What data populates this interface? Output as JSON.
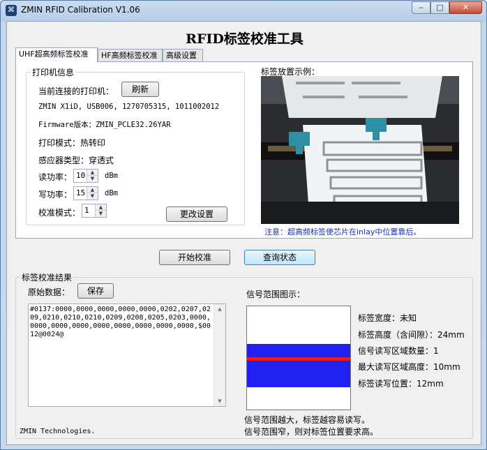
{
  "window": {
    "title": "ZMIN RFID Calibration V1.06",
    "minimize_glyph": "‒",
    "maximize_glyph": "□",
    "close_glyph": "✕"
  },
  "main_title": "RFID标签校准工具",
  "tabs": [
    {
      "label": "UHF超高频标签校准",
      "active": true
    },
    {
      "label": "HF高频标签校准",
      "active": false
    },
    {
      "label": "高级设置",
      "active": false
    }
  ],
  "printer_info": {
    "group_label": "打印机信息",
    "connected_label": "当前连接的打印机：",
    "refresh_button": "刷新",
    "printer_line": "ZMIN X1iD, USB006, 1270705315, 1011002012",
    "firmware_label": "Firmware版本：",
    "firmware_value": "ZMIN_PCLE32.26YAR",
    "print_mode": "打印模式：热转印",
    "sensor_type": "感应器类型：穿透式",
    "read_power_label": "读功率：",
    "read_power_value": "10",
    "write_power_label": "写功率：",
    "write_power_value": "15",
    "power_unit": "dBm",
    "calib_mode_label": "校准模式：",
    "calib_mode_value": "1",
    "change_settings_button": "更改设置"
  },
  "sample": {
    "label": "标签放置示例：",
    "note": "注意：超高频标签使芯片在inlay中位置靠后。",
    "note_color": "#1a2fb0"
  },
  "actions": {
    "start_button": "开始校准",
    "query_button": "查询状态"
  },
  "results": {
    "group_label": "标签校准结果",
    "raw_label": "原始数据：",
    "save_button": "保存",
    "raw_data": "#0137:0000,0000,0000,0000,0000,0202,0207,0209,0210,0210,0210,0209,0208,0205,0203,0000,0000,0000,0000,0000,0000,0000,0000,0000,$0012@0024@",
    "signal_label": "信号范围图示：",
    "signal_colors": {
      "band": "#2020f0",
      "center": "#e81c1c"
    },
    "stats": [
      "标签宽度：未知",
      "标签高度（含间隙）：24mm",
      "信号读写区域数量：1",
      "最大读写区域高度：10mm",
      "标签读写位置：12mm"
    ],
    "hint_1": "信号范围越大，标签越容易读写。",
    "hint_2": "信号范围窄，则对标签位置要求高。",
    "company": "ZMIN Technologies."
  }
}
